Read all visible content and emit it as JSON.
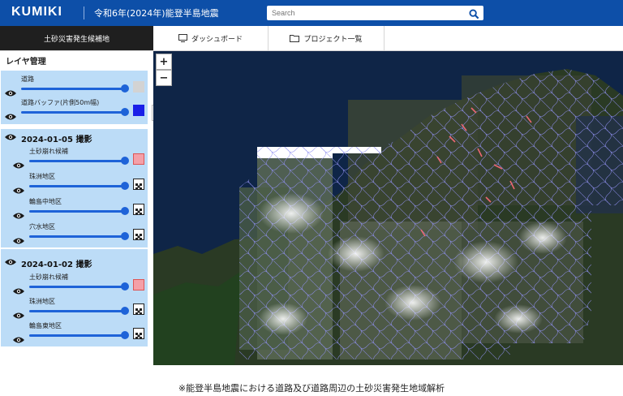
{
  "header": {
    "logo": "KUMIKI",
    "app_title": "令和6年(2024年)能登半島地震",
    "search_placeholder": "Search"
  },
  "nav": {
    "active_tab": "土砂災害発生候補地",
    "dashboard": "ダッシュボード",
    "projects": "プロジェクト一覧"
  },
  "sidebar": {
    "title": "レイヤ管理",
    "base_layers": [
      {
        "label": "道路",
        "color": "#d3d3d3"
      },
      {
        "label": "道路バッファ(片側50m幅)",
        "color": "#1a1fe8"
      }
    ],
    "groups": [
      {
        "date_label": "2024-01-05 撮影",
        "layers": [
          {
            "label": "土砂崩れ候補"
          },
          {
            "label": "珠洲地区"
          },
          {
            "label": "輪島中地区"
          },
          {
            "label": "穴水地区"
          }
        ]
      },
      {
        "date_label": "2024-01-02 撮影",
        "layers": [
          {
            "label": "土砂崩れ候補"
          },
          {
            "label": "珠洲地区"
          },
          {
            "label": "輪島東地区"
          }
        ]
      }
    ],
    "collapse_glyph": "«"
  },
  "map": {
    "zoom_in": "+",
    "zoom_out": "−"
  },
  "colors": {
    "header": "#0d4fa8",
    "group_bg": "#bcdcf7",
    "slider": "#1e63d8",
    "landslide_swatch": "#f4a0a8"
  },
  "caption": "※能登半島地震における道路及び道路周辺の土砂災害発生地域解析"
}
